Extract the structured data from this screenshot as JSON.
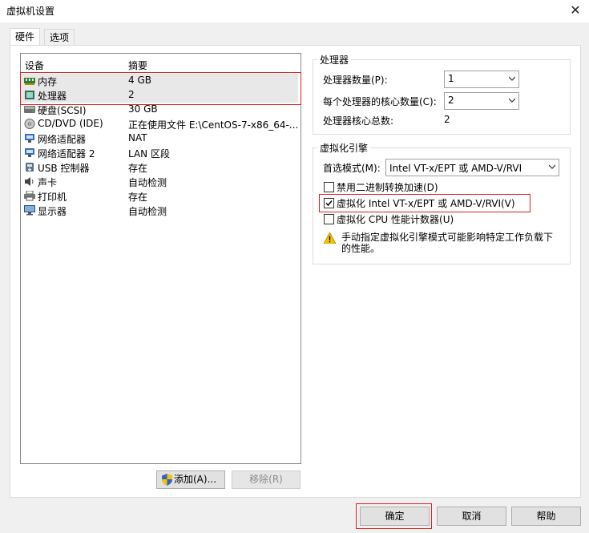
{
  "window": {
    "title": "虚拟机设置",
    "close_glyph": "✕"
  },
  "tabs": [
    {
      "label": "硬件"
    },
    {
      "label": "选项"
    }
  ],
  "device_list": {
    "headers": {
      "device": "设备",
      "summary": "摘要"
    },
    "rows": [
      {
        "name": "内存",
        "summary": "4 GB",
        "icon": "memory-icon"
      },
      {
        "name": "处理器",
        "summary": "2",
        "icon": "processor-icon"
      },
      {
        "name": "硬盘(SCSI)",
        "summary": "30 GB",
        "icon": "hard-disk-icon"
      },
      {
        "name": "CD/DVD (IDE)",
        "summary": "正在使用文件 E:\\CentOS-7-x86_64-...",
        "icon": "cd-dvd-icon"
      },
      {
        "name": "网络适配器",
        "summary": "NAT",
        "icon": "network-adapter-icon"
      },
      {
        "name": "网络适配器 2",
        "summary": "LAN 区段",
        "icon": "network-adapter-icon"
      },
      {
        "name": "USB 控制器",
        "summary": "存在",
        "icon": "usb-icon"
      },
      {
        "name": "声卡",
        "summary": "自动检测",
        "icon": "sound-card-icon"
      },
      {
        "name": "打印机",
        "summary": "存在",
        "icon": "printer-icon"
      },
      {
        "name": "显示器",
        "summary": "自动检测",
        "icon": "display-icon"
      }
    ]
  },
  "buttons": {
    "add": "添加(A)...",
    "remove": "移除(R)",
    "ok": "确定",
    "cancel": "取消",
    "help": "帮助"
  },
  "processor": {
    "group_title": "处理器",
    "count_label": "处理器数量(P):",
    "count_value": "1",
    "cores_label": "每个处理器的核心数量(C):",
    "cores_value": "2",
    "total_label": "处理器核心总数:",
    "total_value": "2"
  },
  "virtualization": {
    "group_title": "虚拟化引擎",
    "mode_label": "首选模式(M):",
    "mode_value": "Intel VT-x/EPT 或 AMD-V/RVI",
    "options": [
      {
        "label": "禁用二进制转换加速(D)",
        "checked": false
      },
      {
        "label": "虚拟化 Intel VT-x/EPT 或 AMD-V/RVI(V)",
        "checked": true
      },
      {
        "label": "虚拟化 CPU 性能计数器(U)",
        "checked": false
      }
    ],
    "warning_text": "手动指定虚拟化引擎模式可能影响特定工作负载下的性能。"
  },
  "colors": {
    "highlight_red": "#e02020",
    "warning_yellow": "#f5c400"
  }
}
